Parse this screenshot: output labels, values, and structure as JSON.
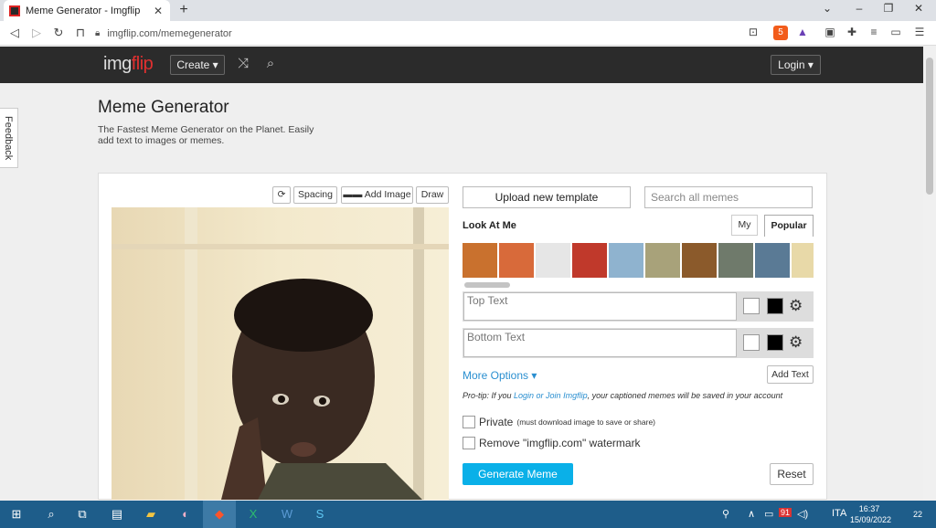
{
  "browser": {
    "tab_title": "Meme Generator - Imgflip",
    "url": "imgflip.com/memegenerator",
    "brave_badge": "5"
  },
  "header": {
    "logo_img": "img",
    "logo_flip": "flip",
    "create_label": "Create ▾",
    "login_label": "Login ▾"
  },
  "feedback_label": "Feedback",
  "page": {
    "title": "Meme Generator",
    "subtitle": "The Fastest Meme Generator on the Planet. Easily add text to images or memes."
  },
  "editor_toolbar": {
    "spacing_label": "Spacing",
    "add_image_label": "Add Image",
    "draw_label": "Draw"
  },
  "templates": {
    "upload_label": "Upload new template",
    "search_placeholder": "Search all memes",
    "current_name": "Look At Me",
    "tab_my": "My",
    "tab_popular": "Popular",
    "thumb_colors": [
      "#c9712e",
      "#d86a3a",
      "#e6e6e6",
      "#c0392b",
      "#8fb3cf",
      "#a8a27a",
      "#8b5a2b",
      "#6f7a6b",
      "#5a7a95",
      "#e8d9a8",
      "#b38b6d"
    ]
  },
  "text_boxes": {
    "top_placeholder": "Top Text",
    "bottom_placeholder": "Bottom Text"
  },
  "options": {
    "more_options_label": "More Options ▾",
    "add_text_label": "Add Text",
    "protip_prefix": "Pro-tip: If you ",
    "protip_link": "Login or Join Imgflip",
    "protip_suffix": ", your captioned memes will be saved in your account",
    "private_label": "Private",
    "private_note": "(must download image to save or share)",
    "watermark_label": "Remove \"imgflip.com\" watermark",
    "generate_label": "Generate Meme",
    "reset_label": "Reset"
  },
  "taskbar": {
    "lang": "ITA",
    "time": "16:37",
    "date": "15/09/2022",
    "battery_badge": "91",
    "notifications": "22"
  }
}
